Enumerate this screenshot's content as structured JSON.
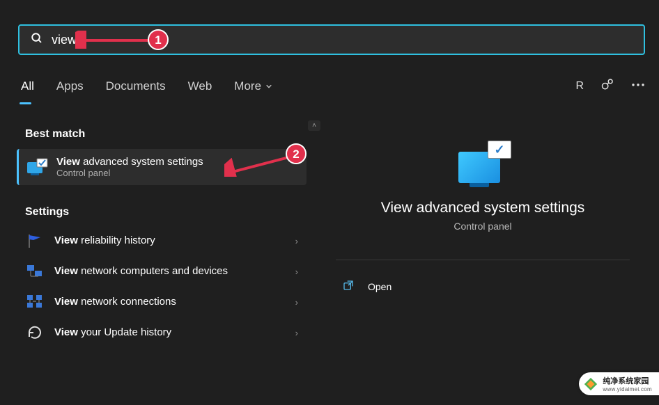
{
  "search": {
    "value": "view"
  },
  "tabs": {
    "all": "All",
    "apps": "Apps",
    "documents": "Documents",
    "web": "Web",
    "more": "More"
  },
  "topright": {
    "user_letter": "R"
  },
  "left": {
    "best_match_label": "Best match",
    "best_match": {
      "bold": "View",
      "rest": " advanced system settings",
      "sub": "Control panel"
    },
    "settings_label": "Settings",
    "items": [
      {
        "bold": "View",
        "rest": " reliability history"
      },
      {
        "bold": "View",
        "rest": " network computers and devices"
      },
      {
        "bold": "View",
        "rest": " network connections"
      },
      {
        "bold": "View",
        "rest": " your Update history"
      }
    ]
  },
  "right": {
    "title": "View advanced system settings",
    "sub": "Control panel",
    "open": "Open"
  },
  "annotations": {
    "one": "1",
    "two": "2"
  },
  "watermark": {
    "line1": "纯净系统家园",
    "line2": "www.yidaimei.com"
  }
}
